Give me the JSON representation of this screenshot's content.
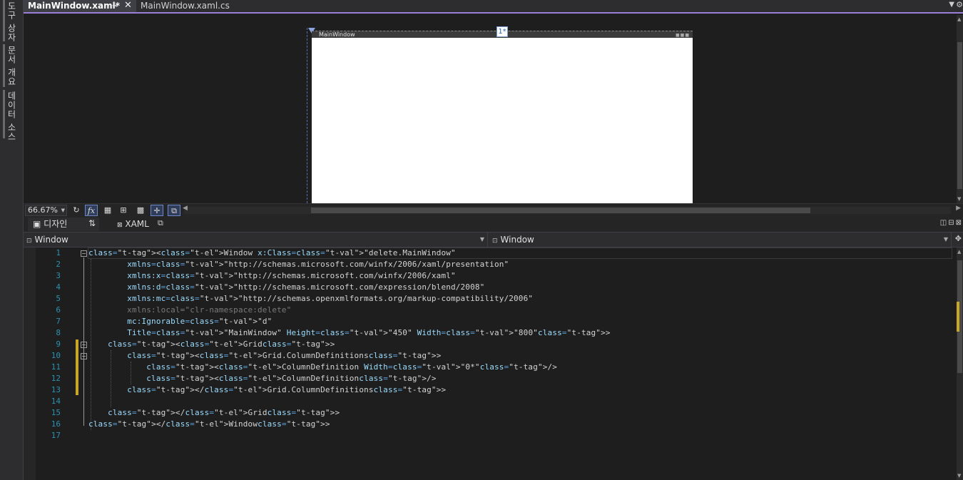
{
  "side_panel": {
    "tabs": [
      "도구 상자",
      "문서 개요",
      "데이터 소스"
    ]
  },
  "document_tabs": [
    {
      "label": "MainWindow.xaml*",
      "active": true
    },
    {
      "label": "MainWindow.xaml.cs",
      "active": false
    }
  ],
  "designer": {
    "window_title": "MainWindow",
    "column_marker": "1*"
  },
  "design_toolbar": {
    "zoom": "66.67%",
    "icons": [
      "refresh-icon",
      "fx-icon",
      "grid-icon",
      "snap-grid-icon",
      "checker-icon",
      "snap-lines-icon",
      "device-icon"
    ]
  },
  "split_tabs": {
    "design_label": "디자인",
    "xaml_label": "XAML"
  },
  "nav_bar": {
    "left_combo": "Window",
    "right_combo": "Window"
  },
  "editor": {
    "line_numbers": [
      "1",
      "2",
      "3",
      "4",
      "5",
      "6",
      "7",
      "8",
      "9",
      "10",
      "11",
      "12",
      "13",
      "14",
      "15",
      "16",
      "17"
    ],
    "lines": [
      "<Window x:Class=\"delete.MainWindow\"",
      "        xmlns=\"http://schemas.microsoft.com/winfx/2006/xaml/presentation\"",
      "        xmlns:x=\"http://schemas.microsoft.com/winfx/2006/xaml\"",
      "        xmlns:d=\"http://schemas.microsoft.com/expression/blend/2008\"",
      "        xmlns:mc=\"http://schemas.openxmlformats.org/markup-compatibility/2006\"",
      "        xmlns:local=\"clr-namespace:delete\"",
      "        mc:Ignorable=\"d\"",
      "        Title=\"MainWindow\" Height=\"450\" Width=\"800\">",
      "    <Grid>",
      "        <Grid.ColumnDefinitions>",
      "            <ColumnDefinition Width=\"0*\"/>",
      "            <ColumnDefinition/>",
      "        </Grid.ColumnDefinitions>",
      "",
      "    </Grid>",
      "</Window>",
      ""
    ]
  },
  "colors": {
    "accent_tab_border": "#9b7ed8",
    "change_bar": "#c8a626",
    "line_number": "#2b91af",
    "xml_tag": "#569cd6",
    "xml_attr": "#9cdcfe",
    "xml_value": "#ce9178"
  }
}
